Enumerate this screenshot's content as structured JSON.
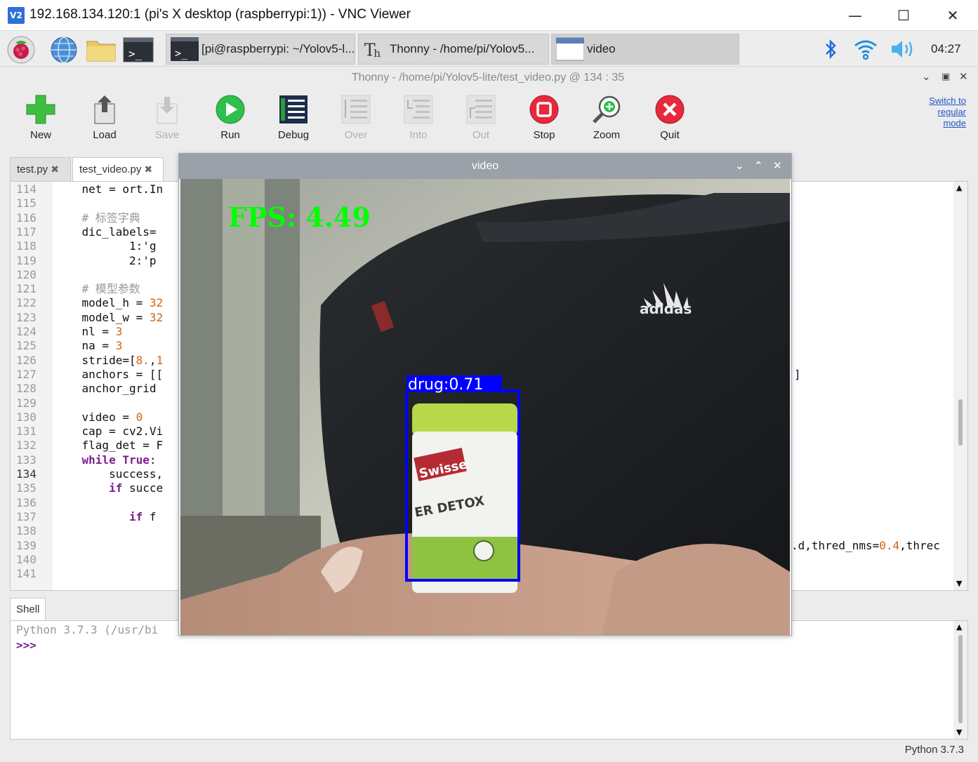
{
  "vnc": {
    "logo": "V2",
    "title": "192.168.134.120:1 (pi's X desktop (raspberrypi:1)) - VNC Viewer",
    "minimize": "—",
    "maximize": "☐",
    "close": "✕"
  },
  "taskbar": {
    "launchers": [
      "raspberry-menu-icon",
      "web-browser-icon",
      "file-manager-icon",
      "terminal-icon"
    ],
    "tasks": [
      {
        "icon": "terminal-icon",
        "label": "[pi@raspberrypi: ~/Yolov5-l..."
      },
      {
        "icon": "thonny-icon",
        "label": "Thonny  -  /home/pi/Yolov5..."
      },
      {
        "icon": "window-icon",
        "label": "video"
      }
    ],
    "tray": [
      "bluetooth-icon",
      "wifi-icon",
      "volume-icon"
    ],
    "clock": "04:27"
  },
  "thonny": {
    "title": "Thonny  -  /home/pi/Yolov5-lite/test_video.py  @  134 : 35",
    "toolbar": [
      {
        "id": "new",
        "label": "New",
        "enabled": true
      },
      {
        "id": "load",
        "label": "Load",
        "enabled": true
      },
      {
        "id": "save",
        "label": "Save",
        "enabled": false
      },
      {
        "id": "run",
        "label": "Run",
        "enabled": true
      },
      {
        "id": "debug",
        "label": "Debug",
        "enabled": true
      },
      {
        "id": "over",
        "label": "Over",
        "enabled": false
      },
      {
        "id": "into",
        "label": "Into",
        "enabled": false
      },
      {
        "id": "out",
        "label": "Out",
        "enabled": false
      },
      {
        "id": "stop",
        "label": "Stop",
        "enabled": true
      },
      {
        "id": "zoom",
        "label": "Zoom",
        "enabled": true
      },
      {
        "id": "quit",
        "label": "Quit",
        "enabled": true
      }
    ],
    "switch_mode": [
      "Switch to",
      "regular",
      "mode"
    ],
    "tabs": [
      {
        "label": "test.py",
        "active": false
      },
      {
        "label": "test_video.py",
        "active": true
      }
    ],
    "current_line": 134,
    "lines": [
      {
        "n": "114",
        "code": "    net = ort.In"
      },
      {
        "n": "115",
        "code": ""
      },
      {
        "n": "116",
        "code": "    # 标签字典"
      },
      {
        "n": "117",
        "code": "    dic_labels="
      },
      {
        "n": "118",
        "code": "           1:'g"
      },
      {
        "n": "119",
        "code": "           2:'p"
      },
      {
        "n": "120",
        "code": ""
      },
      {
        "n": "121",
        "code": "    # 模型参数"
      },
      {
        "n": "122",
        "code": "    model_h = 32"
      },
      {
        "n": "123",
        "code": "    model_w = 32"
      },
      {
        "n": "124",
        "code": "    nl = 3"
      },
      {
        "n": "125",
        "code": "    na = 3"
      },
      {
        "n": "126",
        "code": "    stride=[8.,1"
      },
      {
        "n": "127",
        "code": "    anchors = [["
      },
      {
        "n": "128",
        "code": "    anchor_grid "
      },
      {
        "n": "129",
        "code": ""
      },
      {
        "n": "130",
        "code": "    video = 0"
      },
      {
        "n": "131",
        "code": "    cap = cv2.Vi"
      },
      {
        "n": "132",
        "code": "    flag_det = F"
      },
      {
        "n": "133",
        "code": "    while True:"
      },
      {
        "n": "134",
        "code": "        success,"
      },
      {
        "n": "135",
        "code": "        if succe"
      },
      {
        "n": "136",
        "code": ""
      },
      {
        "n": "137",
        "code": "           if f"
      },
      {
        "n": "138",
        "code": ""
      },
      {
        "n": "139",
        "code": ""
      },
      {
        "n": "140",
        "code": ""
      },
      {
        "n": "141",
        "code": ""
      }
    ],
    "right_fragments": [
      {
        "line": "127",
        "text": "]"
      },
      {
        "line": "139",
        "text": ".d,thred_nms=0.4,threc"
      }
    ],
    "shell_tab": "Shell",
    "shell_lines": [
      "Python 3.7.3 (/usr/bi",
      ">>>"
    ],
    "status": "Python 3.7.3"
  },
  "video": {
    "title": "video",
    "fps_text": "FPS: 4.49",
    "detection_label": "drug:0.71",
    "box_color": "#0000ff",
    "fps_color": "#00ff00",
    "shirt_brand": "adidas",
    "product_brand": "Swisse",
    "product_text": "ER DETOX"
  }
}
